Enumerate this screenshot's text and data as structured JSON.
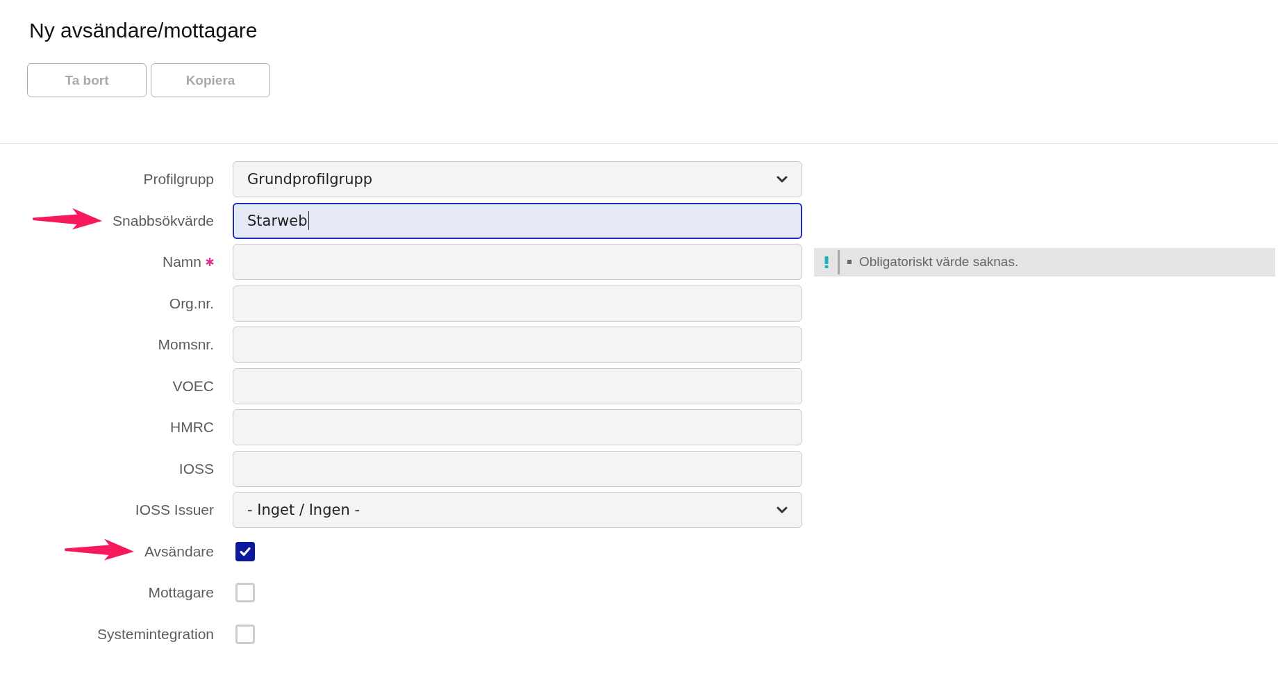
{
  "page": {
    "title": "Ny avsändare/mottagare"
  },
  "toolbar": {
    "buttons": [
      {
        "label": "Ta bort",
        "disabled": true
      },
      {
        "label": "Kopiera",
        "disabled": true
      }
    ]
  },
  "form": {
    "fields": [
      {
        "kind": "select",
        "label": "Profilgrupp",
        "value": "Grundprofilgrupp",
        "required": false,
        "focused": false,
        "marked": false
      },
      {
        "kind": "text",
        "label": "Snabbsökvärde",
        "value": "Starweb",
        "required": false,
        "focused": true,
        "marked": true
      },
      {
        "kind": "text",
        "label": "Namn",
        "required": true,
        "focused": false,
        "marked": false,
        "error": "Obligatoriskt värde saknas."
      },
      {
        "kind": "text",
        "label": "Org.nr.",
        "required": false,
        "focused": false,
        "marked": false
      },
      {
        "kind": "text",
        "label": "Momsnr.",
        "required": false,
        "focused": false,
        "marked": false
      },
      {
        "kind": "text",
        "label": "VOEC",
        "required": false,
        "focused": false,
        "marked": false
      },
      {
        "kind": "text",
        "label": "HMRC",
        "required": false,
        "focused": false,
        "marked": false
      },
      {
        "kind": "text",
        "label": "IOSS",
        "required": false,
        "focused": false,
        "marked": false
      },
      {
        "kind": "select",
        "label": "IOSS Issuer",
        "value": "- Inget / Ingen -",
        "required": false,
        "focused": false,
        "marked": false
      },
      {
        "kind": "checkbox",
        "label": "Avsändare",
        "checked": true,
        "required": false,
        "marked": true
      },
      {
        "kind": "checkbox",
        "label": "Mottagare",
        "checked": false,
        "required": false,
        "marked": false
      },
      {
        "kind": "checkbox",
        "label": "Systemintegration",
        "checked": false,
        "required": false,
        "marked": false
      }
    ]
  }
}
